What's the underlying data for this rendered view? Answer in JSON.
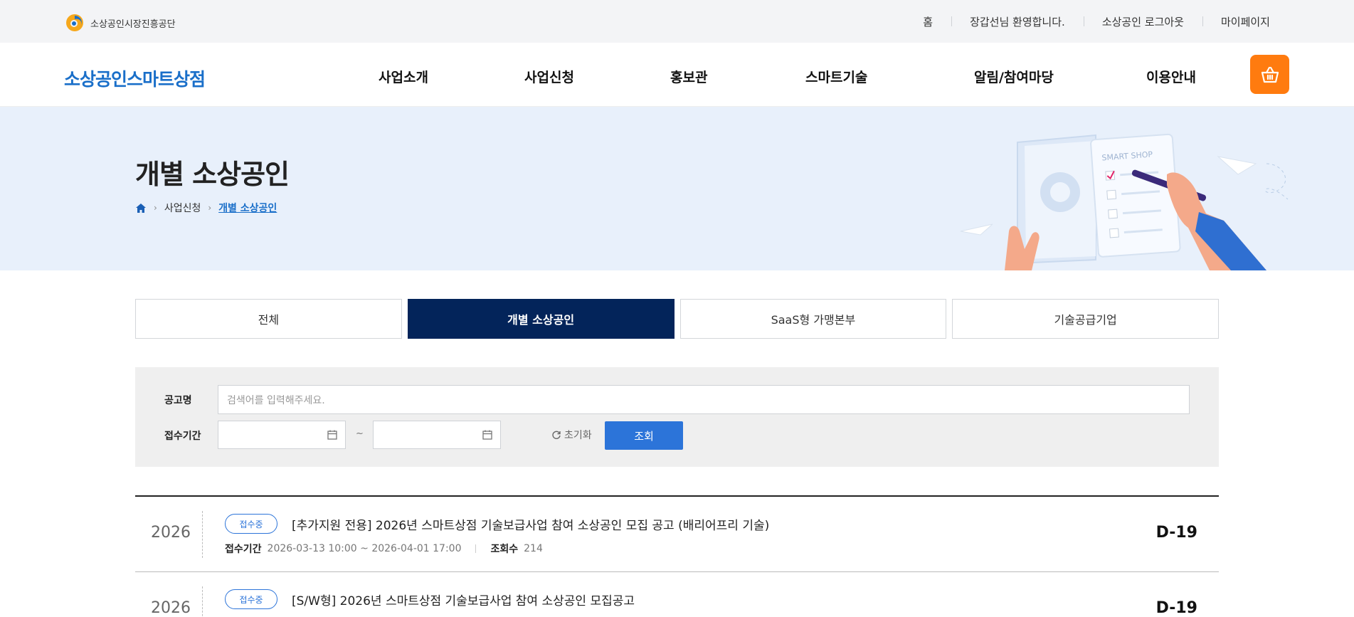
{
  "util": {
    "org_name": "소상공인시장진흥공단",
    "links": [
      "홈",
      "장갑선님 환영합니다.",
      "소상공인 로그아웃",
      "마이페이지"
    ]
  },
  "gnb": {
    "site_title": "소상공인스마트상점",
    "menu": [
      "사업소개",
      "사업신청",
      "홍보관",
      "스마트기술",
      "알림/참여마당",
      "이용안내"
    ],
    "cart_icon": "basket-icon"
  },
  "hero": {
    "title": "개별 소상공인",
    "breadcrumb": [
      "사업신청",
      "개별 소상공인"
    ],
    "illustration_text": "SMART SHOP"
  },
  "tabs": [
    {
      "label": "전체",
      "active": false
    },
    {
      "label": "개별 소상공인",
      "active": true
    },
    {
      "label": "SaaS형 가맹본부",
      "active": false
    },
    {
      "label": "기술공급기업",
      "active": false
    }
  ],
  "search": {
    "name_label": "공고명",
    "name_placeholder": "검색어를 입력해주세요.",
    "period_label": "접수기간",
    "start_date": "",
    "end_date": "",
    "tilde": "~",
    "reset_label": "초기화",
    "search_label": "조회"
  },
  "list": [
    {
      "year": "2026",
      "badge": "접수중",
      "title": "[추가지원 전용] 2026년 스마트상점 기술보급사업 참여 소상공인 모집 공고 (배리어프리 기술)",
      "period_label": "접수기간",
      "period": "2026-03-13 10:00 ~ 2026-04-01 17:00",
      "views_label": "조회수",
      "views": "214",
      "dday": "D-19"
    },
    {
      "year": "2026",
      "badge": "접수중",
      "title": "[S/W형] 2026년 스마트상점 기술보급사업 참여 소상공인 모집공고",
      "period_label": "",
      "period": "",
      "views_label": "",
      "views": "",
      "dday": "D-19"
    }
  ],
  "colors": {
    "brand_blue": "#1a6fc9",
    "navy": "#03245a",
    "orange": "#ff7b0f",
    "button_blue": "#2c74d9",
    "hero_bg": "#e8f0fb"
  }
}
